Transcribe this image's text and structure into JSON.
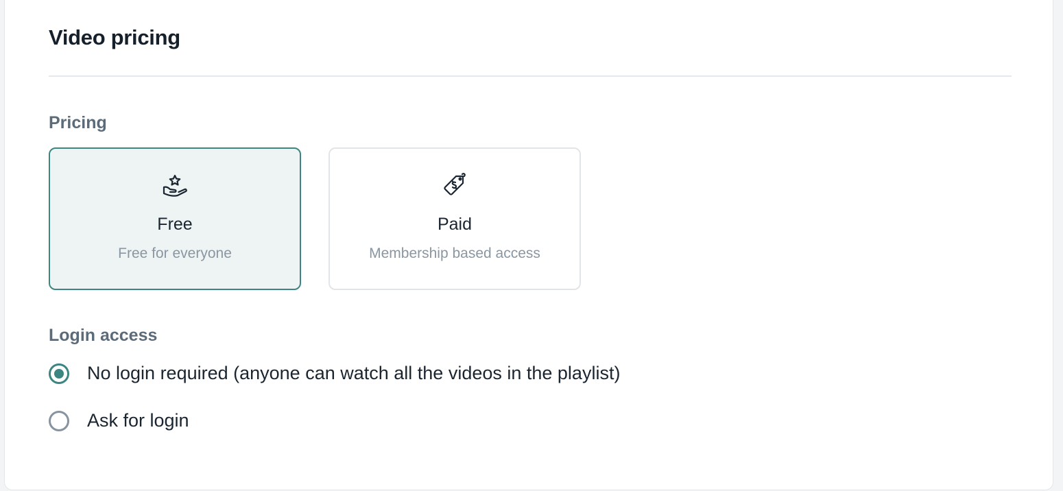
{
  "header": {
    "title": "Video pricing"
  },
  "pricing": {
    "label": "Pricing",
    "options": [
      {
        "title": "Free",
        "subtitle": "Free for everyone",
        "icon": "hand-star-icon",
        "selected": true
      },
      {
        "title": "Paid",
        "subtitle": "Membership based access",
        "icon": "price-tag-icon",
        "selected": false
      }
    ]
  },
  "login_access": {
    "label": "Login access",
    "options": [
      {
        "label": "No login required (anyone can watch all the videos in the playlist)",
        "selected": true
      },
      {
        "label": "Ask for login",
        "selected": false
      }
    ]
  },
  "colors": {
    "accent": "#3c8580",
    "selected_card_bg": "#eef4f4",
    "heading_text": "#15202b",
    "muted_text": "#8a96a1"
  }
}
